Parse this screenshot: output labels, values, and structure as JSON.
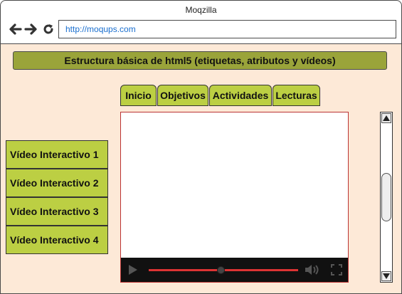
{
  "window": {
    "title": "Moqzilla"
  },
  "navbar": {
    "back_icon": "arrow-left-icon",
    "forward_icon": "arrow-right-icon",
    "reload_icon": "reload-icon",
    "url": "http://moqups.com"
  },
  "page": {
    "header": "Estructura básica de html5 (etiquetas, atributos y vídeos)",
    "tabs": [
      {
        "label": "Inicio"
      },
      {
        "label": "Objetivos"
      },
      {
        "label": "Actividades"
      },
      {
        "label": "Lecturas"
      }
    ],
    "menu": [
      {
        "label": "Vídeo Interactivo 1"
      },
      {
        "label": "Vídeo Interactivo 2"
      },
      {
        "label": "Vídeo Interactivo 3"
      },
      {
        "label": "Vídeo Interactivo 4"
      }
    ]
  },
  "video": {
    "progress": 0.48,
    "controls": [
      "play-icon",
      "volume-icon",
      "fullscreen-icon"
    ]
  },
  "scrollbar": {
    "position": 0.5
  },
  "colors": {
    "content_bg": "#fde9d7",
    "header_bg": "#9aa43a",
    "tab_bg": "#bccf43",
    "url_text": "#1a6fcf",
    "progress_track": "#d33"
  }
}
